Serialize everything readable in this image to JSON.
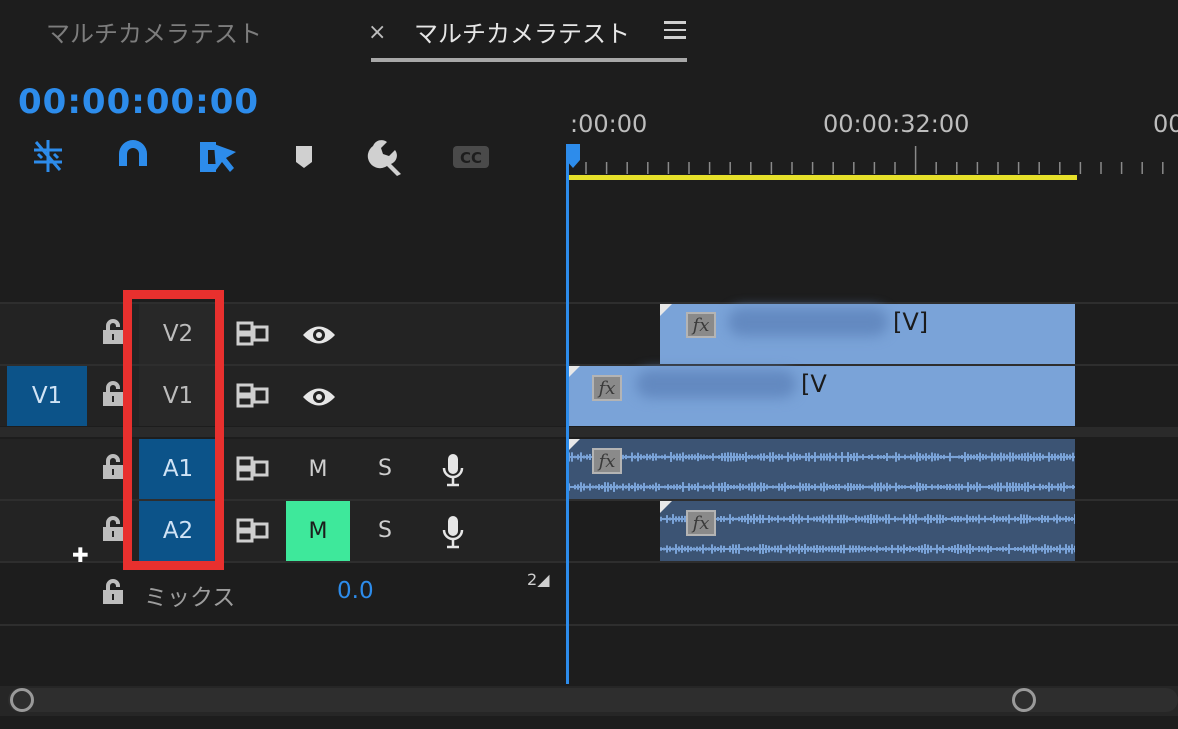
{
  "tabs": {
    "inactive_label": "マルチカメラテスト",
    "active_label": "マルチカメラテスト",
    "close": "×"
  },
  "timecode": "00:00:00:00",
  "tools": [
    "nest-icon",
    "snap-magnet-icon",
    "linked-selection-icon",
    "add-marker-icon",
    "settings-wrench-icon",
    "captions-cc-icon"
  ],
  "ruler": {
    "labels": [
      ":00:00",
      "00:00:32:00",
      "00"
    ]
  },
  "tracks": {
    "source_patch": "V1",
    "video": [
      {
        "name": "V2",
        "targeted": false
      },
      {
        "name": "V1",
        "targeted": false
      }
    ],
    "audio": [
      {
        "name": "A1",
        "targeted": true,
        "mute": "M",
        "solo": "S",
        "muted": false
      },
      {
        "name": "A2",
        "targeted": true,
        "mute": "M",
        "solo": "S",
        "muted": true
      }
    ],
    "mix": {
      "label": "ミックス",
      "value": "0.0",
      "channels": "2"
    }
  },
  "clips": {
    "fx_label": "fx",
    "video_tag": "[V]",
    "v1_tag": "[V",
    "v2_tag": "[V]"
  },
  "colors": {
    "accent": "#2d8ceb",
    "clip_video": "#7aa3d8",
    "clip_audio": "#3c5474",
    "target_on": "#0c5389",
    "mute_on": "#3ee89b",
    "highlight_box": "#e8302e",
    "work_area": "#e6e02a"
  }
}
